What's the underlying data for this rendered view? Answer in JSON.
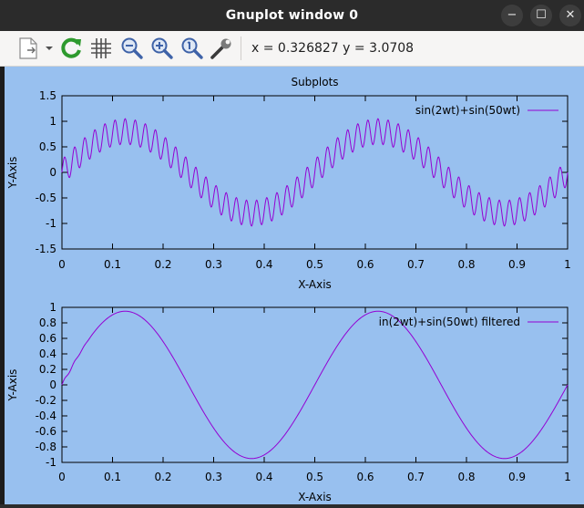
{
  "window": {
    "title": "Gnuplot window 0",
    "minimize_glyph": "−",
    "maximize_glyph": "☐",
    "close_glyph": "✕"
  },
  "toolbar": {
    "items": [
      "copy-menu-icon",
      "replot-icon",
      "grid-icon",
      "zoom-out-icon",
      "zoom-in-icon",
      "zoom-reset-icon",
      "settings-icon"
    ],
    "coordinates": "x = 0.326827 y = 3.0708"
  },
  "colors": {
    "plot_background": "#98c0ef",
    "series_line": "#9400d3",
    "axis": "#000000"
  },
  "chart_data": [
    {
      "type": "line",
      "title": "Subplots",
      "xlabel": "X-Axis",
      "ylabel": "Y-Axis",
      "xlim": [
        0,
        1
      ],
      "ylim": [
        -1.5,
        1.5
      ],
      "xticks": [
        "0",
        "0.1",
        "0.2",
        "0.3",
        "0.4",
        "0.5",
        "0.6",
        "0.7",
        "0.8",
        "0.9",
        "1"
      ],
      "yticks": [
        "1.5",
        "1",
        "0.5",
        "0",
        "-0.5",
        "-1",
        "-1.5"
      ],
      "grid": false,
      "legend_position": "top-right",
      "series": [
        {
          "name": "sin(2wt)+sin(50wt)",
          "formula": "0.8*sin(2*pi*2*x) + 0.25*sin(2*pi*50*x)",
          "samples": 1000
        }
      ]
    },
    {
      "type": "line",
      "title": "",
      "xlabel": "X-Axis",
      "ylabel": "Y-Axis",
      "xlim": [
        0,
        1
      ],
      "ylim": [
        -1,
        1
      ],
      "xticks": [
        "0",
        "0.1",
        "0.2",
        "0.3",
        "0.4",
        "0.5",
        "0.6",
        "0.7",
        "0.8",
        "0.9",
        "1"
      ],
      "yticks": [
        "1",
        "0.8",
        "0.6",
        "0.4",
        "0.2",
        "0",
        "-0.2",
        "-0.4",
        "-0.6",
        "-0.8",
        "-1"
      ],
      "grid": false,
      "legend_position": "top-right",
      "series": [
        {
          "name": "in(2wt)+sin(50wt) filtered",
          "formula": "0.95*sin(2*pi*2*x), with small ripple before x=0.06",
          "samples": 400
        }
      ]
    }
  ]
}
